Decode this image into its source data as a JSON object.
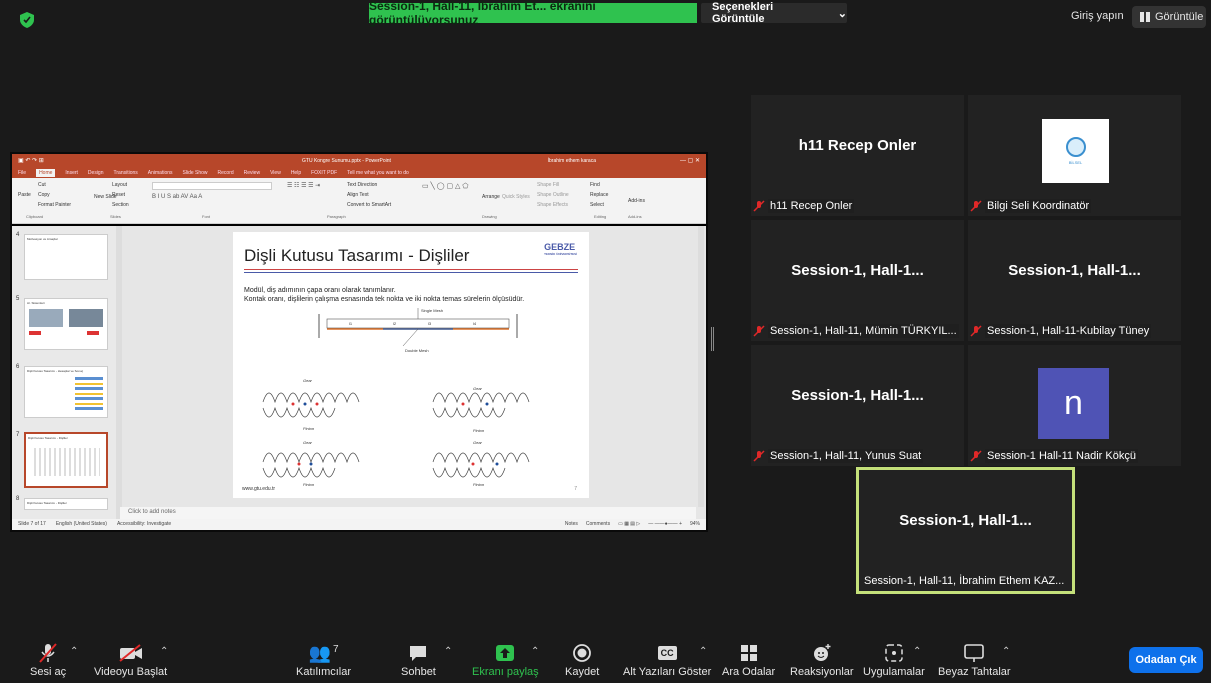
{
  "top": {
    "share_banner": "Session-1, Hall-11, İbrahim Et... ekranını görüntülüyorsunuz",
    "view_options": "Seçenekleri Görüntüle",
    "view_options_chevron": "⌄",
    "sign_in": "Giriş yapın",
    "view": "Görüntüle"
  },
  "ppt": {
    "window_title": "GTU Kongre Sunumu.pptx - PowerPoint",
    "user": "İbrahim ethem karaca",
    "tabs": [
      "File",
      "Home",
      "Insert",
      "Design",
      "Transitions",
      "Animations",
      "Slide Show",
      "Record",
      "Review",
      "View",
      "Help",
      "FOXIT PDF",
      "Tell me what you want to do"
    ],
    "ribbon": {
      "paste": "Paste",
      "cut": "Cut",
      "copy": "Copy",
      "format_painter": "Format Painter",
      "new_slide": "New Slide",
      "layout": "Layout",
      "reset": "Reset",
      "section": "Section",
      "find": "Find",
      "replace": "Replace",
      "select": "Select",
      "arrange": "Arrange",
      "quick_styles": "Quick Styles",
      "shape_fill": "Shape Fill",
      "shape_outline": "Shape Outline",
      "shape_effects": "Shape Effects",
      "text_direction": "Text Direction",
      "align_text": "Align Text",
      "convert_smartart": "Convert to SmartArt",
      "add_ins": "Add-ins",
      "groups": [
        "Clipboard",
        "Slides",
        "Font",
        "Paragraph",
        "Drawing",
        "Editing",
        "Add-ins"
      ]
    },
    "thumbnails": [
      {
        "num": "4",
        "title": "Motivasyon ve Amaçlar"
      },
      {
        "num": "5",
        "title": "Ar. Sistemleri"
      },
      {
        "num": "6",
        "title": "Dişli Kutusu Tasarımı - Hesaplar ve Sonuç"
      },
      {
        "num": "7",
        "title": "Dişli Kutusu Tasarımı - Dişliler"
      },
      {
        "num": "8",
        "title": "Dişli Kutusu Tasarımı - Dişliler"
      }
    ],
    "slide": {
      "title": "Dişli Kutusu Tasarımı - Dişliler",
      "logo": "GEBZE",
      "logo_sub": "TEKNİK ÜNİVERSİTESİ",
      "line1": "Modül, diş adımının çapa oranı olarak tanımlanır.",
      "line2": "Kontak oranı, dişlilerin çalışma esnasında tek nokta ve iki nokta temas sürelerin ölçüsüdür.",
      "single_mesh": "Single Mesh",
      "double_mesh": "Double Mesh",
      "gear": "Gear",
      "pinion": "Pinion",
      "segments": [
        "l1",
        "l2",
        "l3",
        "l4"
      ],
      "footer": "www.gtu.edu.tr",
      "page": "7"
    },
    "notes_placeholder": "Click to add notes",
    "status": {
      "slide_of": "Slide 7 of 17",
      "language": "English (United States)",
      "accessibility": "Accessibility: Investigate",
      "notes": "Notes",
      "comments": "Comments",
      "zoom": "94%"
    }
  },
  "gallery": [
    {
      "big": "h11 Recep Onler",
      "label": "h11 Recep Onler"
    },
    {
      "big": "",
      "label": "Bilgi Seli Koordinatör",
      "logo_text": "BİLSEL"
    },
    {
      "big": "Session-1,  Hall-1...",
      "label": "Session-1, Hall-11, Mümin TÜRKYIL..."
    },
    {
      "big": "Session-1,  Hall-1...",
      "label": "Session-1, Hall-11-Kubilay Tüney"
    },
    {
      "big": "Session-1,  Hall-1...",
      "label": "Session-1, Hall-11, Yunus Suat"
    },
    {
      "big": "",
      "label": "Session-1 Hall-11 Nadir Kökçü",
      "avatar": "n",
      "avatar_color": "#4f53b5"
    },
    {
      "big": "Session-1,  Hall-1...",
      "label": "Session-1, Hall-11, İbrahim Ethem KAZ..."
    }
  ],
  "toolbar": {
    "unmute": "Sesi aç",
    "start_video": "Videoyu Başlat",
    "participants": "Katılımcılar",
    "participants_count": "7",
    "chat": "Sohbet",
    "share_screen": "Ekranı paylaş",
    "record": "Kaydet",
    "captions": "Alt Yazıları Göster",
    "breakout": "Ara Odalar",
    "reactions": "Reaksiyonlar",
    "apps": "Uygulamalar",
    "whiteboards": "Beyaz Tahtalar",
    "leave": "Odadan Çık",
    "cc_badge": "CC"
  },
  "colors": {
    "share_banner": "#2fc24f",
    "leave": "#0e71eb",
    "active_speaker": "#c4e07a",
    "mic_off": "#e02828",
    "ppt_accent": "#b7472a"
  }
}
